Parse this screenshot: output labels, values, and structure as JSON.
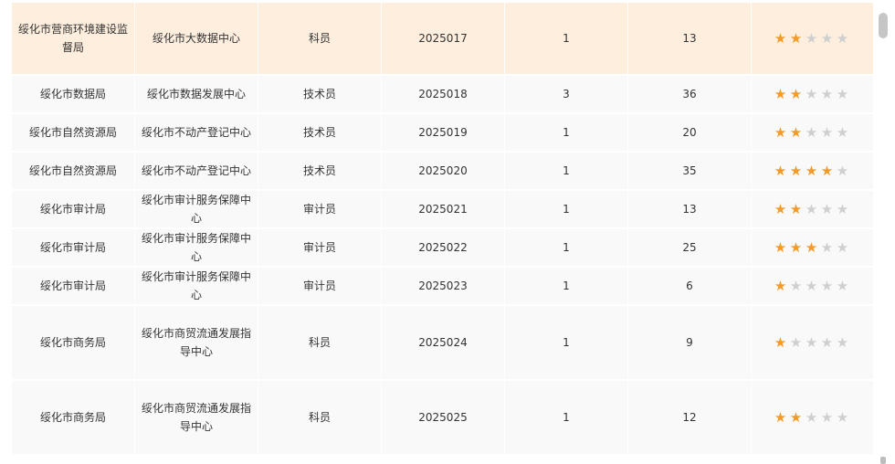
{
  "rows": [
    {
      "dept": "绥化市营商环境建设监督局",
      "unit": "绥化市大数据中心",
      "position": "科员",
      "code": "2025017",
      "count": "1",
      "applicants": "13",
      "rating": 2
    },
    {
      "dept": "绥化市数据局",
      "unit": "绥化市数据发展中心",
      "position": "技术员",
      "code": "2025018",
      "count": "3",
      "applicants": "36",
      "rating": 2
    },
    {
      "dept": "绥化市自然资源局",
      "unit": "绥化市不动产登记中心",
      "position": "技术员",
      "code": "2025019",
      "count": "1",
      "applicants": "20",
      "rating": 2
    },
    {
      "dept": "绥化市自然资源局",
      "unit": "绥化市不动产登记中心",
      "position": "技术员",
      "code": "2025020",
      "count": "1",
      "applicants": "35",
      "rating": 4
    },
    {
      "dept": "绥化市审计局",
      "unit": "绥化市审计服务保障中心",
      "position": "审计员",
      "code": "2025021",
      "count": "1",
      "applicants": "13",
      "rating": 2
    },
    {
      "dept": "绥化市审计局",
      "unit": "绥化市审计服务保障中心",
      "position": "审计员",
      "code": "2025022",
      "count": "1",
      "applicants": "25",
      "rating": 3
    },
    {
      "dept": "绥化市审计局",
      "unit": "绥化市审计服务保障中心",
      "position": "审计员",
      "code": "2025023",
      "count": "1",
      "applicants": "6",
      "rating": 1
    },
    {
      "dept": "绥化市商务局",
      "unit": "绥化市商贸流通发展指导中心",
      "position": "科员",
      "code": "2025024",
      "count": "1",
      "applicants": "9",
      "rating": 1
    },
    {
      "dept": "绥化市商务局",
      "unit": "绥化市商贸流通发展指导中心",
      "position": "科员",
      "code": "2025025",
      "count": "1",
      "applicants": "12",
      "rating": 2
    }
  ],
  "star_max": 5,
  "colors": {
    "star_on": "#f29a2a",
    "star_off": "#cfcfcf",
    "highlight_row": "#fdeedd",
    "row": "#f9f9f9"
  },
  "icons": {
    "star": "star-icon"
  }
}
